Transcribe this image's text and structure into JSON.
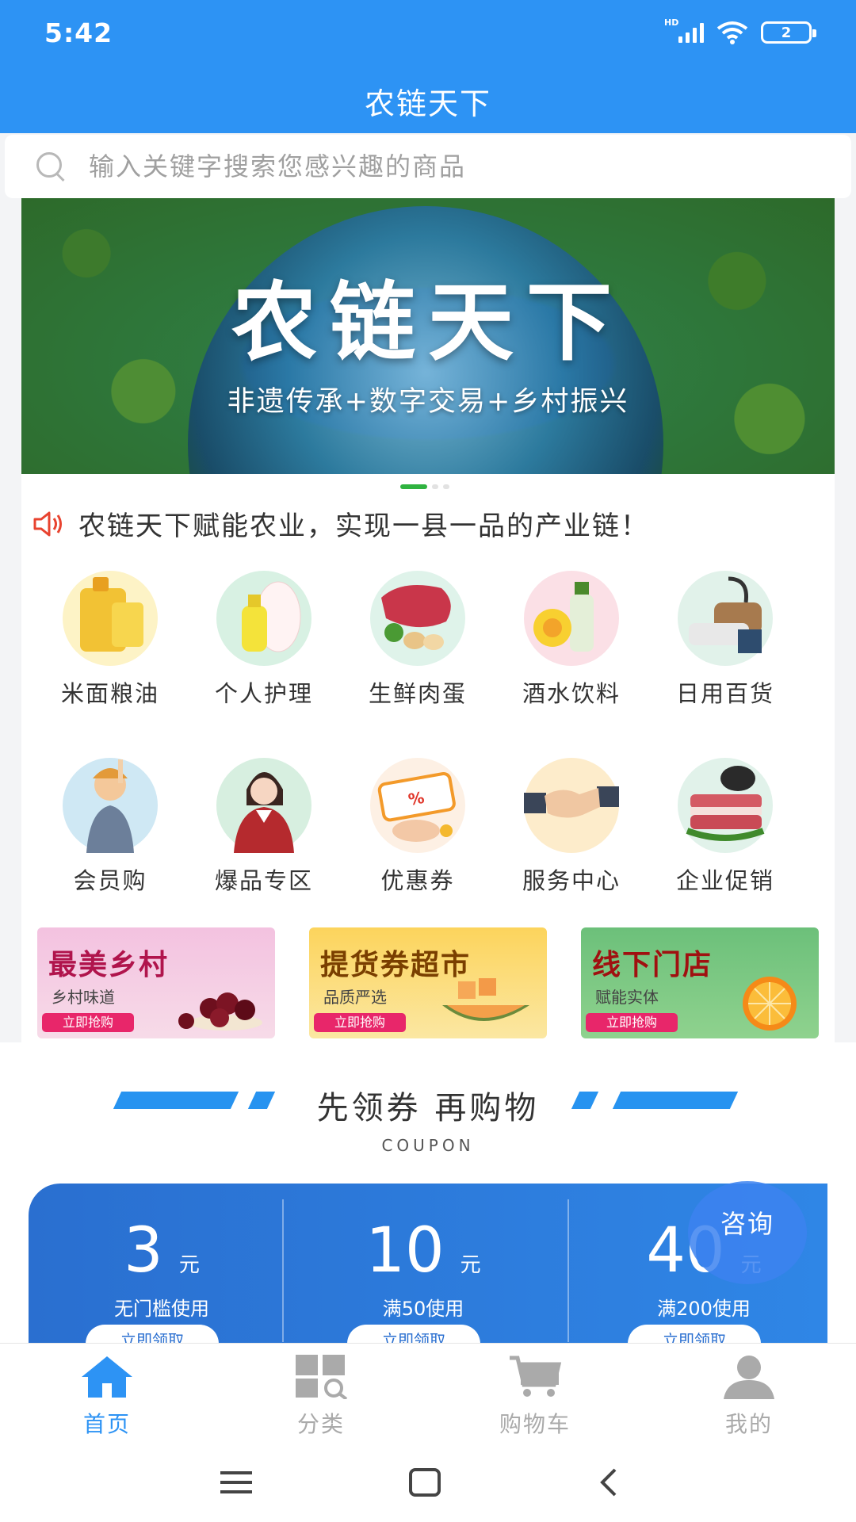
{
  "status": {
    "time": "5:42",
    "network": "HD",
    "battery": "2"
  },
  "app": {
    "title": "农链天下"
  },
  "search": {
    "placeholder": "输入关键字搜索您感兴趣的商品"
  },
  "banner": {
    "title": "农链天下",
    "subtitle": "非遗传承+数字交易+乡村振兴",
    "slides": 3,
    "active_slide": 1
  },
  "notice": {
    "text": "农链天下赋能农业，实现一县一品的产业链！"
  },
  "categories": [
    {
      "label": "米面粮油",
      "icon": "oil-icon"
    },
    {
      "label": "个人护理",
      "icon": "lotion-icon"
    },
    {
      "label": "生鲜肉蛋",
      "icon": "meat-icon"
    },
    {
      "label": "酒水饮料",
      "icon": "drinks-icon"
    },
    {
      "label": "日用百货",
      "icon": "vacuum-icon"
    },
    {
      "label": "会员购",
      "icon": "member-icon"
    },
    {
      "label": "爆品专区",
      "icon": "hot-item-icon"
    },
    {
      "label": "优惠券",
      "icon": "coupon-icon"
    },
    {
      "label": "服务中心",
      "icon": "handshake-icon"
    },
    {
      "label": "企业促销",
      "icon": "pork-icon"
    }
  ],
  "promos": [
    {
      "title": "最美乡村",
      "subtitle": "乡村味道",
      "button": "立即抢购",
      "bg": "#f4c6dc",
      "title_color": "#b0144c"
    },
    {
      "title": "提货券超市",
      "subtitle": "品质严选",
      "button": "立即抢购",
      "bg": "#fbd25d",
      "title_color": "#7a3f00"
    },
    {
      "title": "线下门店",
      "subtitle": "赋能实体",
      "button": "立即抢购",
      "bg": "#74c26e",
      "title_color": "#a01010"
    }
  ],
  "coupon_section": {
    "title": "先领券 再购物",
    "subtitle": "COUPON",
    "coupons": [
      {
        "amount": "3",
        "unit": "元",
        "condition": "无门槛使用",
        "button": "立即领取"
      },
      {
        "amount": "10",
        "unit": "元",
        "condition": "满50使用",
        "button": "立即领取"
      },
      {
        "amount": "40",
        "unit": "元",
        "condition": "满200使用",
        "button": "立即领取"
      }
    ],
    "consult_label": "咨询"
  },
  "tabs": [
    {
      "label": "首页",
      "icon": "home-icon",
      "active": true
    },
    {
      "label": "分类",
      "icon": "category-icon",
      "active": false
    },
    {
      "label": "购物车",
      "icon": "cart-icon",
      "active": false
    },
    {
      "label": "我的",
      "icon": "profile-icon",
      "active": false
    }
  ],
  "colors": {
    "primary": "#2d93f4",
    "accent_red": "#e8266a",
    "coupon_blue": "#2a6fd0"
  }
}
